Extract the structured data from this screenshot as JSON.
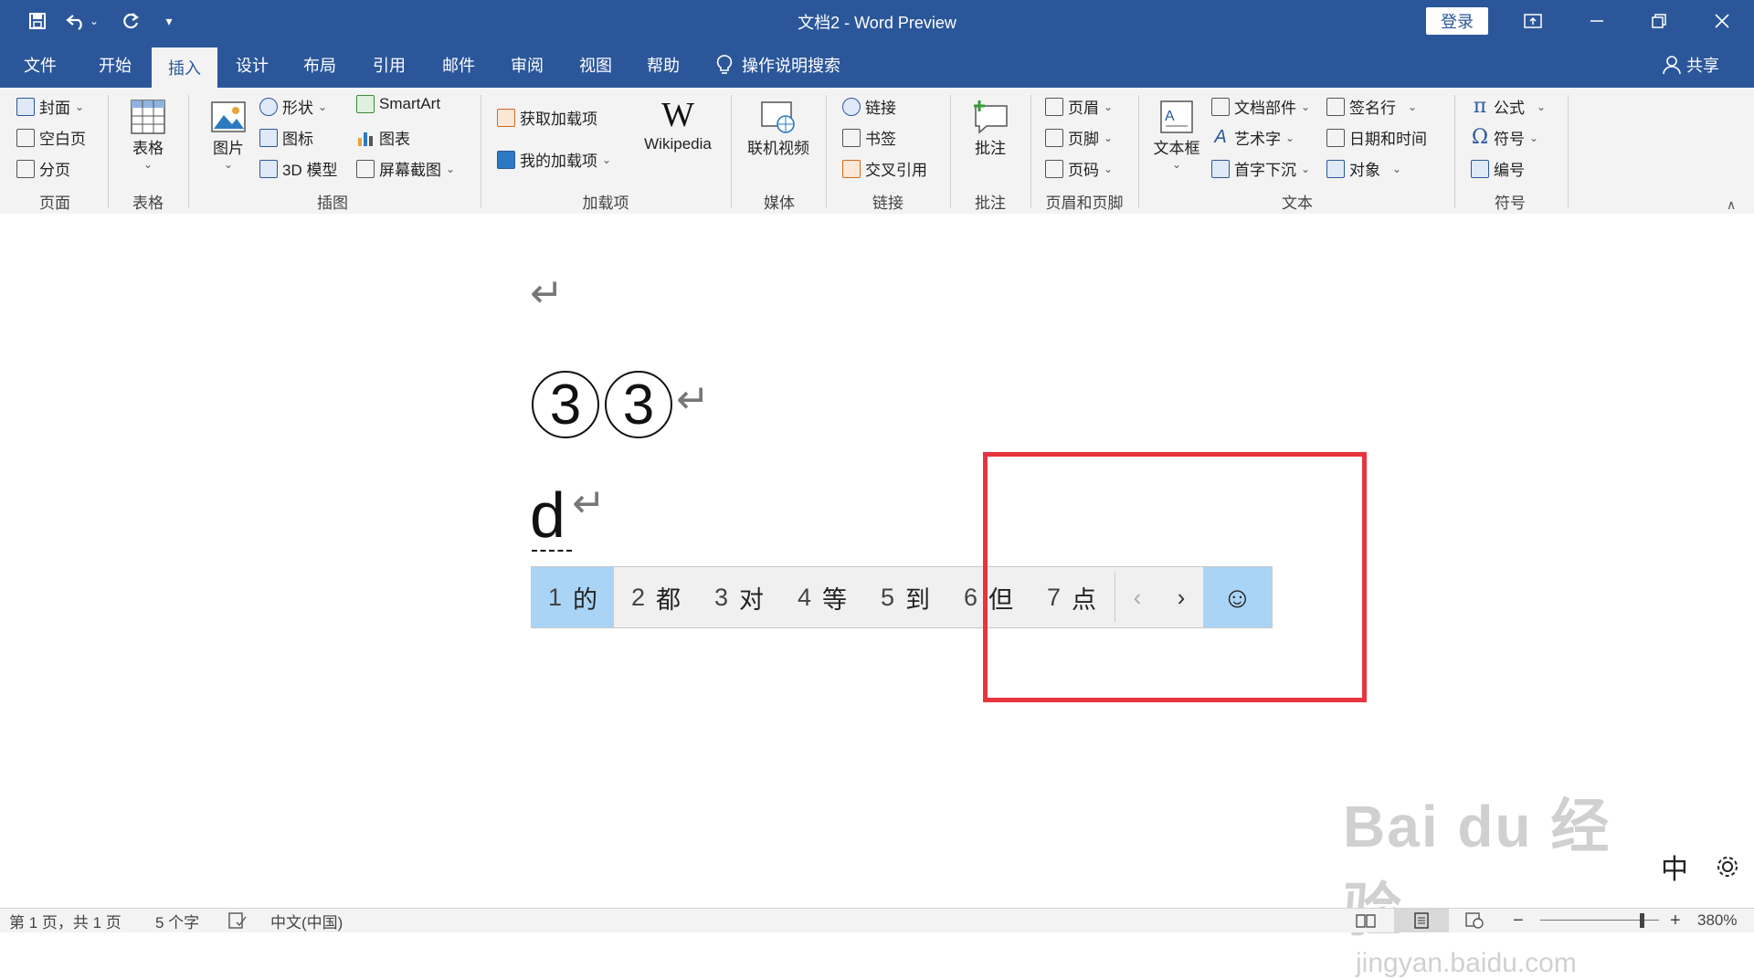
{
  "titlebar": {
    "title": "文档2  -  Word Preview",
    "login_label": "登录",
    "qa_save_icon": "save-icon",
    "qa_undo_icon": "undo-icon",
    "qa_redo_icon": "redo-icon"
  },
  "tabs": [
    {
      "label": "文件"
    },
    {
      "label": "开始"
    },
    {
      "label": "插入"
    },
    {
      "label": "设计"
    },
    {
      "label": "布局"
    },
    {
      "label": "引用"
    },
    {
      "label": "邮件"
    },
    {
      "label": "审阅"
    },
    {
      "label": "视图"
    },
    {
      "label": "帮助"
    }
  ],
  "tell_me": "操作说明搜索",
  "share": "共享",
  "ribbon": {
    "page": {
      "cover": "封面",
      "blank": "空白页",
      "break": "分页",
      "group": "页面"
    },
    "table": {
      "table": "表格",
      "group": "表格"
    },
    "illustrations": {
      "picture": "图片",
      "shapes": "形状",
      "icons": "图标",
      "model3d": "3D 模型",
      "smartart": "SmartArt",
      "chart": "图表",
      "screenshot": "屏幕截图",
      "group": "插图"
    },
    "addins": {
      "get": "获取加载项",
      "my": "我的加载项",
      "wikipedia": "Wikipedia",
      "group": "加载项"
    },
    "media": {
      "video": "联机视频",
      "group": "媒体"
    },
    "links": {
      "link": "链接",
      "bookmark": "书签",
      "cross": "交叉引用",
      "group": "链接"
    },
    "comments": {
      "comment": "批注",
      "group": "批注"
    },
    "header_footer": {
      "header": "页眉",
      "footer": "页脚",
      "page_number": "页码",
      "group": "页眉和页脚"
    },
    "text": {
      "textbox": "文本框",
      "parts": "文档部件",
      "wordart": "艺术字",
      "dropcap": "首字下沉",
      "signature": "签名行",
      "datetime": "日期和时间",
      "object": "对象",
      "group": "文本"
    },
    "symbols": {
      "equation": "公式",
      "symbol": "符号",
      "number": "编号",
      "group": "符号"
    }
  },
  "document": {
    "circled_1": "3",
    "circled_2": "3",
    "typed_char": "d",
    "ime_candidates": [
      {
        "num": "1",
        "text": "的"
      },
      {
        "num": "2",
        "text": "都"
      },
      {
        "num": "3",
        "text": "对"
      },
      {
        "num": "4",
        "text": "等"
      },
      {
        "num": "5",
        "text": "到"
      },
      {
        "num": "6",
        "text": "但"
      },
      {
        "num": "7",
        "text": "点"
      }
    ],
    "ime_prev": "‹",
    "ime_next": "›",
    "ime_emoji": "☺",
    "ime_mode": "中"
  },
  "watermark": {
    "brand": "Bai du 经验",
    "url": "jingyan.baidu.com"
  },
  "status": {
    "page": "第 1 页，共 1 页",
    "words": "5 个字",
    "language": "中文(中国)",
    "zoom": "380%",
    "zoom_minus": "−",
    "zoom_plus": "+"
  }
}
